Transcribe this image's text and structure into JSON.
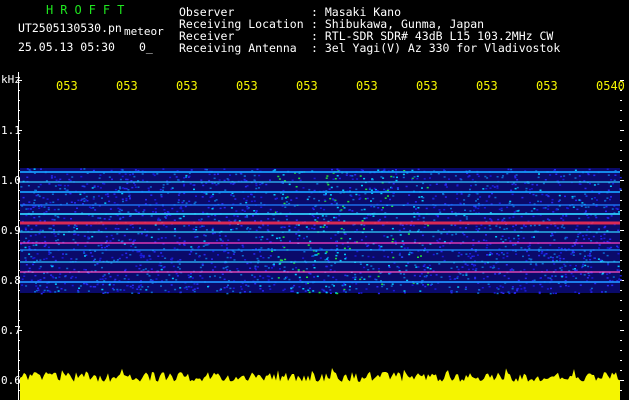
{
  "header": {
    "title": "HROFFT",
    "filename": "UT2505130530.pn",
    "meteor_label": "meteor",
    "datetime": "25.05.13 05:30",
    "count": "0_"
  },
  "info": {
    "labels": [
      "Observer",
      "Receiving Location",
      "Receiver",
      "Receiving Antenna"
    ],
    "values": [
      ": Masaki Kano",
      ": Shibukawa, Gunma, Japan",
      ": RTL-SDR SDR# 43dB L15 103.2MHz CW",
      ": 3el Yagi(V) Az 330 for Vladivostok"
    ]
  },
  "axis": {
    "unit": "kHz",
    "y_labels": [
      "1.1",
      "1.0",
      "0.9",
      "0.8",
      "0.7",
      "0.6"
    ],
    "x_labels": [
      "053",
      "053",
      "053",
      "053",
      "053",
      "053",
      "053",
      "053",
      "053",
      "0540"
    ]
  },
  "colors": {
    "text": "#ffffff",
    "title": "#1fe61f",
    "tick": "#f5f500",
    "noise": "#1010c8",
    "cyan": "#00e6ff",
    "green": "#20ff40",
    "carrier": "#ff3050",
    "amplitude": "#f5f500"
  }
}
